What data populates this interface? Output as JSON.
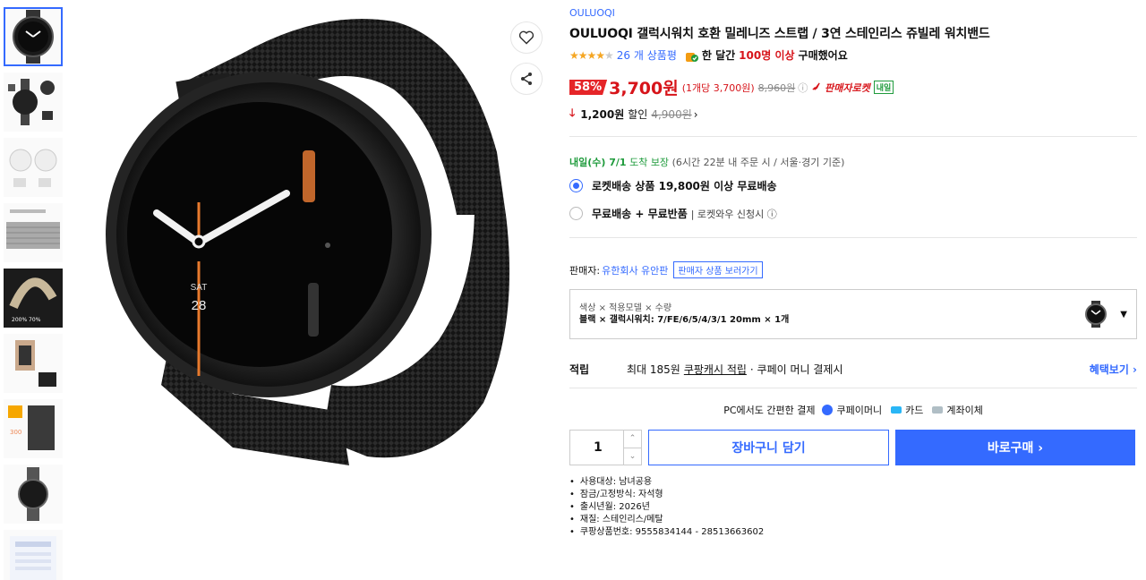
{
  "product": {
    "brand": "OULUOQI",
    "title": "OULUOQI 갤럭시워치 호환 밀레니즈 스트랩 / 3연 스테인리스 쥬빌레 워치밴드",
    "rating": {
      "stars_filled": 4,
      "stars_total": 5,
      "review_count": "26 개 상품평"
    },
    "buy_note": {
      "prefix": "한 달간",
      "highlight": "100명 이상",
      "suffix": "구매했어요"
    }
  },
  "price": {
    "discount": "58%",
    "sale": "3,700원",
    "unit": "(1개당 3,700원)",
    "original": "8,960원",
    "info_icon": "ⓘ",
    "seller_rocket": "판매자로켓",
    "tomorrow_tag": "내일",
    "coupon_amount": "1,200원",
    "coupon_label": "할인",
    "coupon_strike": "4,900원",
    "coupon_chevron": "›"
  },
  "delivery": {
    "date": "내일(수) 7/1",
    "guarantee": "도착 보장",
    "condition": "(6시간 22분 내 주문 시 / 서울·경기 기준)",
    "options": [
      {
        "label": "로켓배송 상품 19,800원 이상 무료배송",
        "sub": "",
        "selected": true
      },
      {
        "label": "무료배송 + 무료반품",
        "sub": "| 로켓와우 신청시 ⓘ",
        "selected": false
      }
    ]
  },
  "seller": {
    "prefix": "판매자:",
    "name": "유한회사 유안판",
    "link": "판매자 상품 보러가기"
  },
  "option_select": {
    "labels": "색상 × 적용모델 × 수량",
    "value": "블랙 × 갤럭시워치: 7/FE/6/5/4/3/1 20mm × 1개"
  },
  "reward": {
    "key": "적립",
    "text": "최대 185원",
    "link": "쿠팡캐시 적립",
    "tail": "· 쿠페이 머니 결제시",
    "benefit": "혜택보기 ›"
  },
  "pay": {
    "intro": "PC에서도 간편한 결제",
    "methods": [
      "쿠페이머니",
      "카드",
      "계좌이체"
    ],
    "colors": [
      "#346aff",
      "#29b6f6",
      "#b0bec5"
    ]
  },
  "cart": {
    "quantity": "1",
    "cart_label": "장바구니 담기",
    "buy_label": "바로구매 ›"
  },
  "attributes": [
    "사용대상: 남녀공용",
    "잠금/고정방식: 자석형",
    "출시년월: 2026년",
    "재질: 스테인리스/메탈",
    "쿠팡상품번호: 9555834144 - 28513663602"
  ],
  "watch_face": {
    "day": "SAT",
    "date": "28"
  },
  "thumb_text": {
    "t4": "200%  70%",
    "t7": "300"
  },
  "colors": {
    "accent": "#346aff",
    "sale": "#d7141a",
    "badge": "#e52528",
    "green": "#1f9b3c"
  }
}
